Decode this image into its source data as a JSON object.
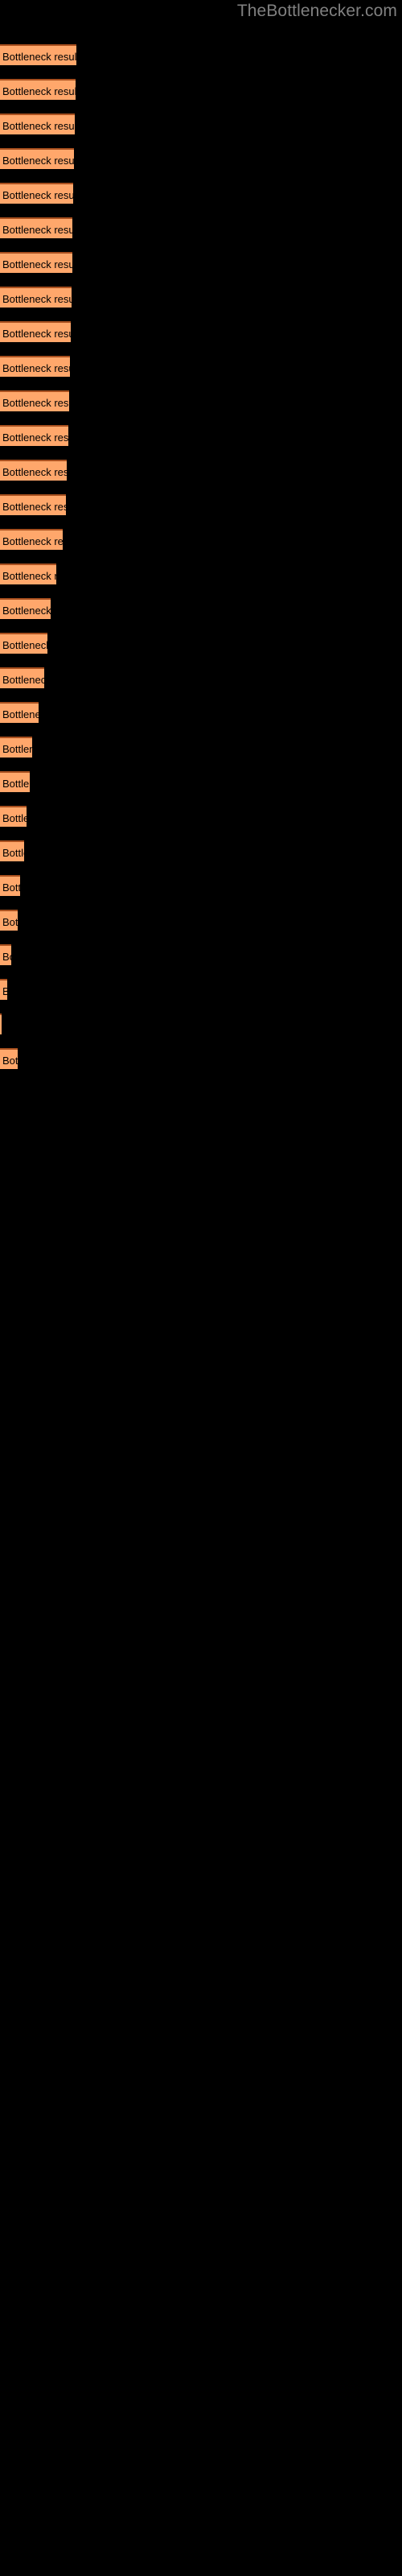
{
  "site": {
    "watermark": "TheBottlenecker.com",
    "watermark_color": "#808080"
  },
  "theme": {
    "background": "#000000",
    "bar_fill": "#FFA76B",
    "bar_border_top": "#A9501F",
    "bar_label_color": "#000000"
  },
  "chart_data": {
    "type": "bar",
    "orientation": "horizontal",
    "title": "",
    "subtitle": "",
    "xlabel": "",
    "ylabel": "",
    "grid": false,
    "legend": false,
    "axis_labels_visible": false,
    "tick_labels_visible": false,
    "bar_label_text": "Bottleneck result",
    "xlim": [
      0,
      500
    ],
    "units": "pixels",
    "note": "Each bar is labeled 'Bottleneck result'; the label is clipped to the bar width so shorter bars show only a prefix of the text.",
    "categories": [
      "Bottleneck result",
      "Bottleneck result",
      "Bottleneck result",
      "Bottleneck result",
      "Bottleneck result",
      "Bottleneck result",
      "Bottleneck result",
      "Bottleneck result",
      "Bottleneck result",
      "Bottleneck result",
      "Bottleneck result",
      "Bottleneck result",
      "Bottleneck result",
      "Bottleneck result",
      "Bottleneck result",
      "Bottleneck result",
      "Bottleneck result",
      "Bottleneck result",
      "Bottleneck result",
      "Bottleneck result",
      "Bottleneck result",
      "Bottleneck result",
      "Bottleneck result",
      "Bottleneck result",
      "Bottleneck result",
      "Bottleneck result",
      "Bottleneck result",
      "Bottleneck result",
      "Bottleneck result",
      "Bottleneck result"
    ],
    "values": [
      95,
      94,
      93,
      92,
      91,
      90,
      90,
      89,
      88,
      87,
      86,
      85,
      83,
      82,
      78,
      70,
      63,
      59,
      55,
      48,
      40,
      37,
      33,
      30,
      25,
      22,
      14,
      9,
      2,
      22
    ],
    "bar_tops": [
      55,
      98,
      141,
      184,
      227,
      270,
      313,
      356,
      399,
      442,
      485,
      528,
      571,
      614,
      657,
      700,
      743,
      786,
      829,
      872,
      915,
      958,
      1001,
      1044,
      1087,
      1130,
      1173,
      1216,
      1259,
      1302
    ]
  }
}
